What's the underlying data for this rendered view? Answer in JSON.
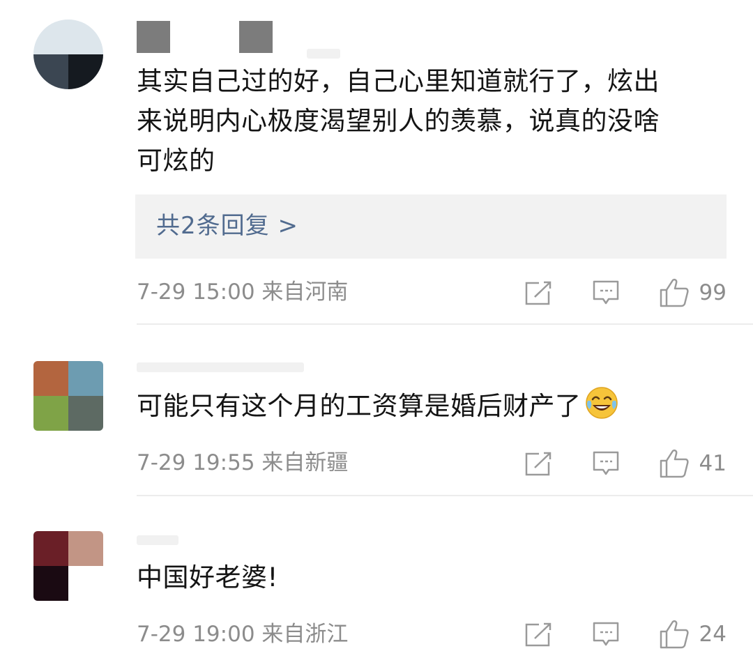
{
  "comments": [
    {
      "text_lines": [
        "其实自己过的好，自己心里知道就行了，炫出",
        "来说明内心极度渴望别人的羡慕，说真的没啥",
        "可炫的"
      ],
      "reply_link": "共2条回复 >",
      "time": "7-29 15:00",
      "location": "来自河南",
      "likes": "99"
    },
    {
      "text": "可能只有这个月的工资算是婚后财产了",
      "time": "7-29 19:55",
      "location": "来自新疆",
      "likes": "41"
    },
    {
      "text": "中国好老婆!",
      "time": "7-29 19:00",
      "location": "来自浙江",
      "likes": "24"
    }
  ],
  "icons": {
    "share": "share-icon",
    "reply": "comment-icon",
    "like": "thumbs-up-icon",
    "emoji": "laughing-tears-emoji"
  }
}
